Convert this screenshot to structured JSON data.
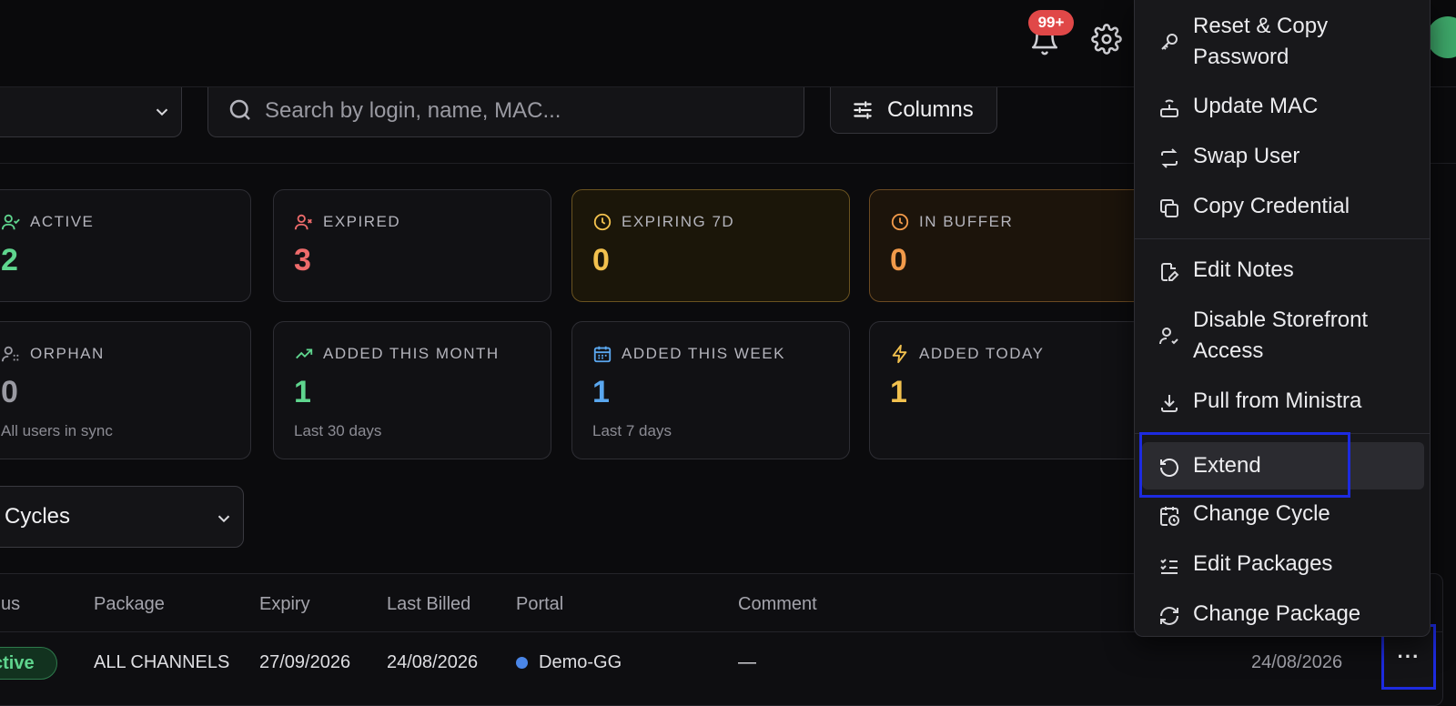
{
  "header": {
    "notifications_badge": "99+"
  },
  "toolbar": {
    "search_placeholder": "Search by login, name, MAC...",
    "columns_label": "Columns"
  },
  "stats": {
    "active": {
      "label": "ACTIVE",
      "value": "2",
      "color": "#5fd58e"
    },
    "expired": {
      "label": "EXPIRED",
      "value": "3",
      "color": "#ee6b6b"
    },
    "expiring": {
      "label": "EXPIRING 7D",
      "value": "0",
      "color": "#f2c14e"
    },
    "buffer": {
      "label": "IN BUFFER",
      "value": "0",
      "color": "#f19a4a"
    },
    "orphan": {
      "label": "ORPHAN",
      "value": "0",
      "sub": "All users in sync",
      "color": "#9a9aa2"
    },
    "month": {
      "label": "ADDED THIS MONTH",
      "value": "1",
      "sub": "Last 30 days",
      "color": "#5fd58e"
    },
    "week": {
      "label": "ADDED THIS WEEK",
      "value": "1",
      "sub": "Last 7 days",
      "color": "#5aa7ef"
    },
    "today": {
      "label": "ADDED TODAY",
      "value": "1",
      "color": "#f2c14e"
    }
  },
  "cycles_filter": {
    "value": "Cycles"
  },
  "table": {
    "headers": {
      "status": "us",
      "package": "Package",
      "expiry": "Expiry",
      "last_billed": "Last Billed",
      "portal": "Portal",
      "comment": "Comment"
    },
    "row": {
      "status": "ctive",
      "package": "ALL CHANNELS",
      "expiry": "27/09/2026",
      "last_billed": "24/08/2026",
      "portal": "Demo-GG",
      "comment": "—",
      "right_date": "24/08/2026",
      "actions": "···"
    }
  },
  "context_menu": {
    "items": [
      {
        "label": "Reset & Copy Password",
        "icon": "key-icon"
      },
      {
        "label": "Update MAC",
        "icon": "router-icon"
      },
      {
        "label": "Swap User",
        "icon": "swap-icon"
      },
      {
        "label": "Copy Credential",
        "icon": "copy-icon"
      },
      {
        "label": "Edit Notes",
        "icon": "note-edit-icon"
      },
      {
        "label": "Disable Storefront Access",
        "icon": "user-check-icon"
      },
      {
        "label": "Pull from Ministra",
        "icon": "download-icon"
      },
      {
        "label": "Extend",
        "icon": "rotate-icon"
      },
      {
        "label": "Change Cycle",
        "icon": "calendar-clock-icon"
      },
      {
        "label": "Edit Packages",
        "icon": "checklist-icon"
      },
      {
        "label": "Change Package",
        "icon": "refresh-icon"
      }
    ]
  }
}
